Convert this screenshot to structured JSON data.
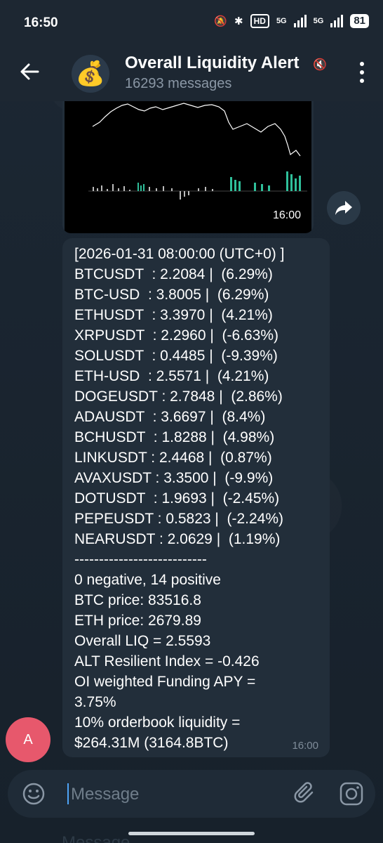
{
  "status": {
    "time": "16:50",
    "hd": "HD",
    "net1": "5G",
    "net2": "5G",
    "battery": "81"
  },
  "header": {
    "title": "Overall Liquidity Alert",
    "subtitle": "16293 messages",
    "avatar_emoji": "💰"
  },
  "chart_message": {
    "time": "16:00"
  },
  "message": {
    "time": "16:00",
    "text": "[2026-01-31 08:00:00 (UTC+0) ]\nBTCUSDT  : 2.2084 |  (6.29%)\nBTC-USD  : 3.8005 |  (6.29%)\nETHUSDT  : 3.3970 |  (4.21%)\nXRPUSDT  : 2.2960 |  (-6.63%)\nSOLUSDT  : 0.4485 |  (-9.39%)\nETH-USD  : 2.5571 |  (4.21%)\nDOGEUSDT : 2.7848 |  (2.86%)\nADAUSDT  : 3.6697 |  (8.4%)\nBCHUSDT  : 1.8288 |  (4.98%)\nLINKUSDT : 2.4468 |  (0.87%)\nAVAXUSDT : 3.3500 |  (-9.9%)\nDOTUSDT  : 1.9693 |  (-2.45%)\nPEPEUSDT : 0.5823 |  (-2.24%)\nNEARUSDT : 2.0629 |  (1.19%)\n---------------------------\n0 negative, 14 positive\nBTC price: 83516.8\nETH price: 2679.89\nOverall LIQ = 2.5593\nALT Resilient Index = -0.426\nOI weighted Funding APY =\n3.75%\n10% orderbook liquidity =\n$264.31M (3164.8BTC)"
  },
  "user_avatar": {
    "letter": "A"
  },
  "input": {
    "placeholder": "Message"
  },
  "ghost": {
    "left": "Message"
  },
  "colors": {
    "accent": "#4ea4f6",
    "avatar": "#e7586c",
    "bubble": "#222e3a"
  }
}
